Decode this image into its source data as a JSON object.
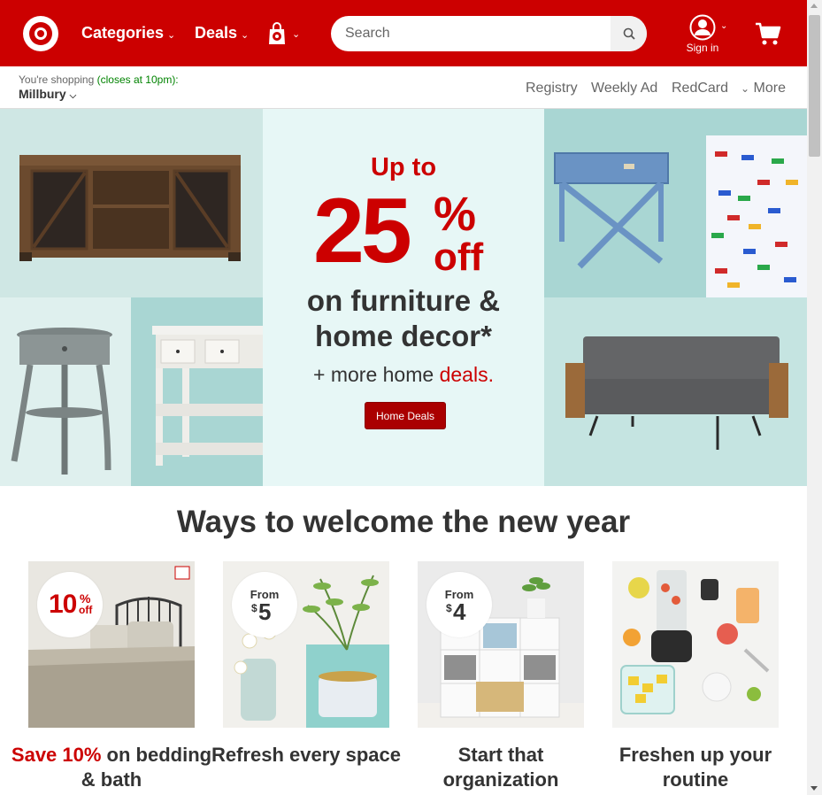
{
  "header": {
    "categories_label": "Categories",
    "deals_label": "Deals",
    "search_placeholder": "Search",
    "signin_label": "Sign in",
    "brand_color": "#cc0000"
  },
  "store": {
    "prefix": "You're shopping",
    "closes": "(closes at 10pm):",
    "name": "Millbury"
  },
  "sublinks": {
    "registry": "Registry",
    "weekly_ad": "Weekly Ad",
    "redcard": "RedCard",
    "more": "More"
  },
  "hero": {
    "up_to": "Up to",
    "percent": "25",
    "percent_sign": "%",
    "off": "off",
    "line1": "on furniture &",
    "line2": "home decor*",
    "more_prefix": "+ more home ",
    "more_highlight": "deals.",
    "button_label": "Home Deals"
  },
  "section": {
    "title": "Ways to welcome the new year"
  },
  "cards": [
    {
      "badge_main": "10",
      "badge_sub": "%",
      "badge_off": "off",
      "caption_red": "Save 10%",
      "caption_rest": " on bedding & bath"
    },
    {
      "badge_top": "From",
      "badge_value": "5",
      "badge_currency": "$",
      "caption": "Refresh every space"
    },
    {
      "badge_top": "From",
      "badge_value": "4",
      "badge_currency": "$",
      "caption": "Start that organization"
    },
    {
      "caption": "Freshen up your routine"
    }
  ],
  "icons": {
    "logo": "target-bullseye-logo",
    "bag": "gift-bag-icon",
    "search": "search-icon",
    "account": "user-account-icon",
    "cart": "shopping-cart-icon"
  }
}
